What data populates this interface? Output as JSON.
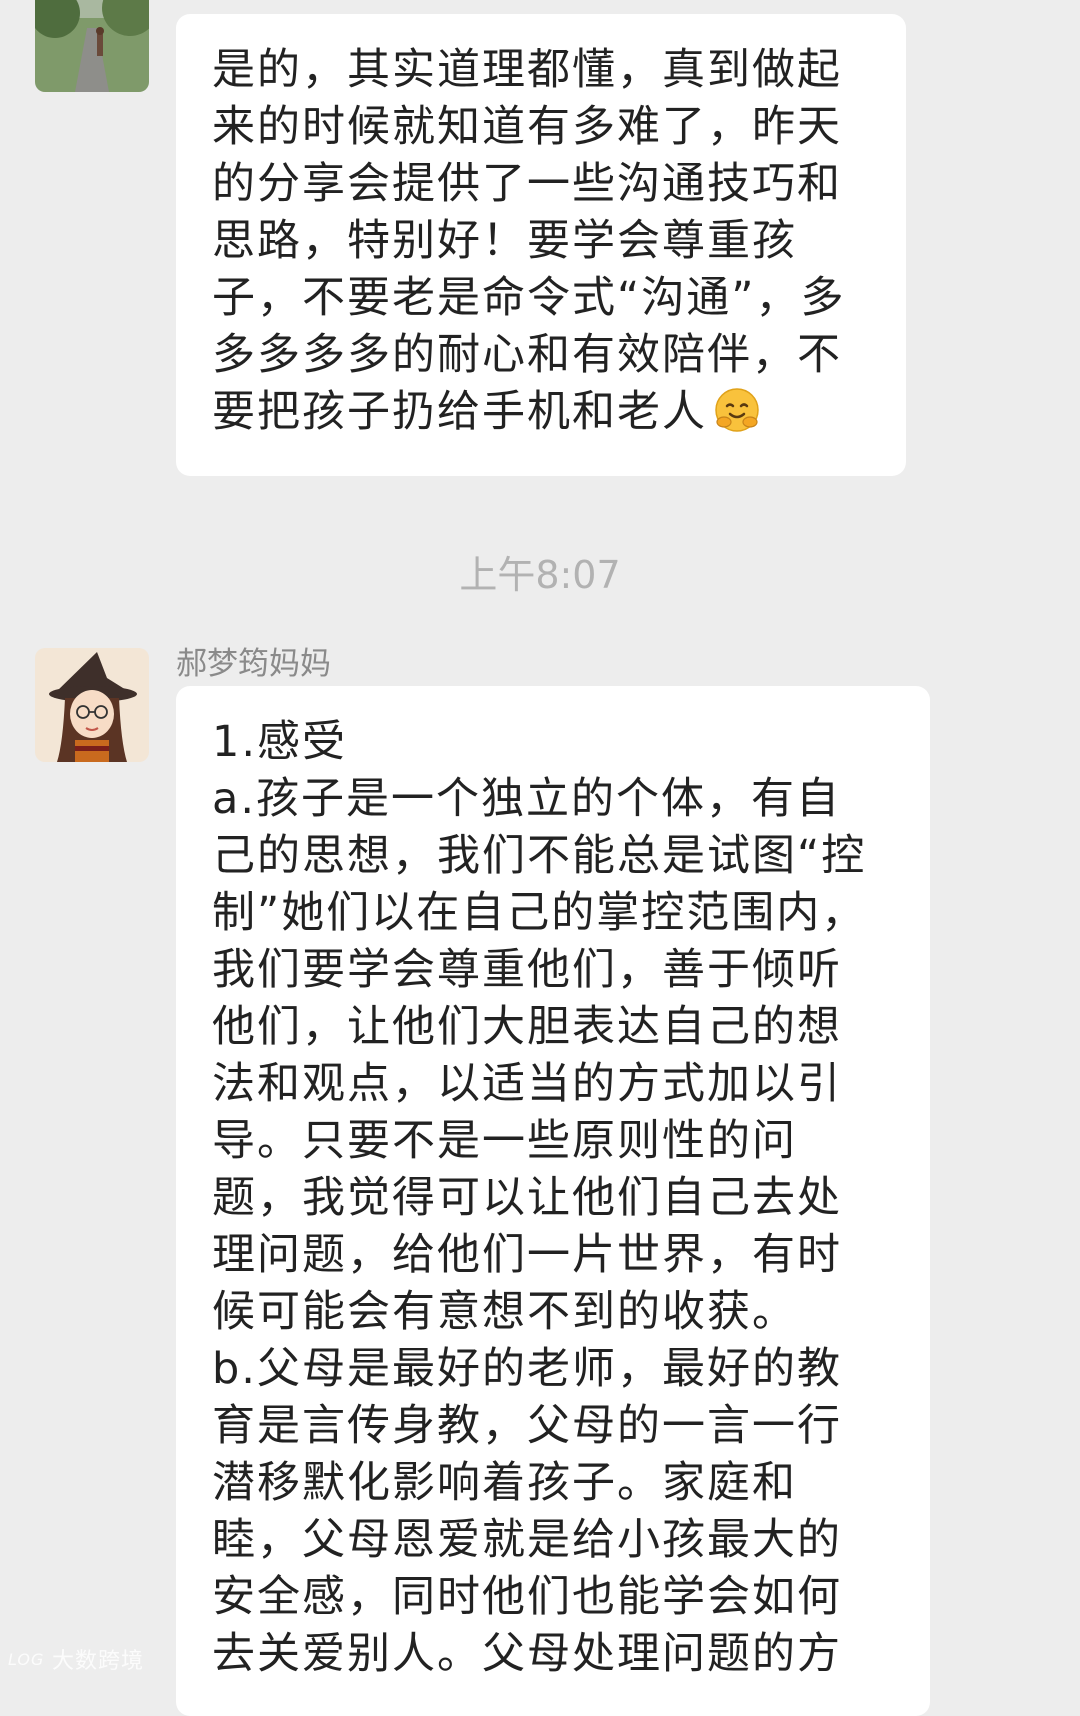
{
  "messages": [
    {
      "lines": [
        "是的，其实道理都懂，真到做起",
        "来的时候就知道有多难了，昨天",
        "的分享会提供了一些沟通技巧和",
        "思路，特别好！要学会尊重孩",
        "子，不要老是命令式“沟通”，多",
        "多多多多的耐心和有效陪伴，不",
        "要把孩子扔给手机和老人"
      ],
      "emoji_icon": "hugging-face-emoji"
    },
    {
      "timestamp": "上午8:07",
      "sender": "郝梦筠妈妈",
      "lines": [
        "1.感受",
        "a.孩子是一个独立的个体，有自",
        "己的思想，我们不能总是试图“控",
        "制”她们以在自己的掌控范围内，",
        "我们要学会尊重他们，善于倾听",
        "他们，让他们大胆表达自己的想",
        "法和观点，以适当的方式加以引",
        "导。只要不是一些原则性的问",
        "题，我觉得可以让他们自己去处",
        "理问题，给他们一片世界，有时",
        "候可能会有意想不到的收获。",
        "b.父母是最好的老师，最好的教",
        "育是言传身教，父母的一言一行",
        "潜移默化影响着孩子。家庭和",
        "睦，父母恩爱就是给小孩最大的",
        "安全感，同时他们也能学会如何",
        "去关爱别人。父母处理问题的方"
      ]
    }
  ],
  "watermark": {
    "logo_text": "LOGO",
    "text": "大数跨境"
  },
  "colors": {
    "background": "#ededed",
    "bubble": "#ffffff",
    "text": "#222222",
    "timestamp": "#b2b2b2",
    "sender": "#8a8a8a"
  }
}
